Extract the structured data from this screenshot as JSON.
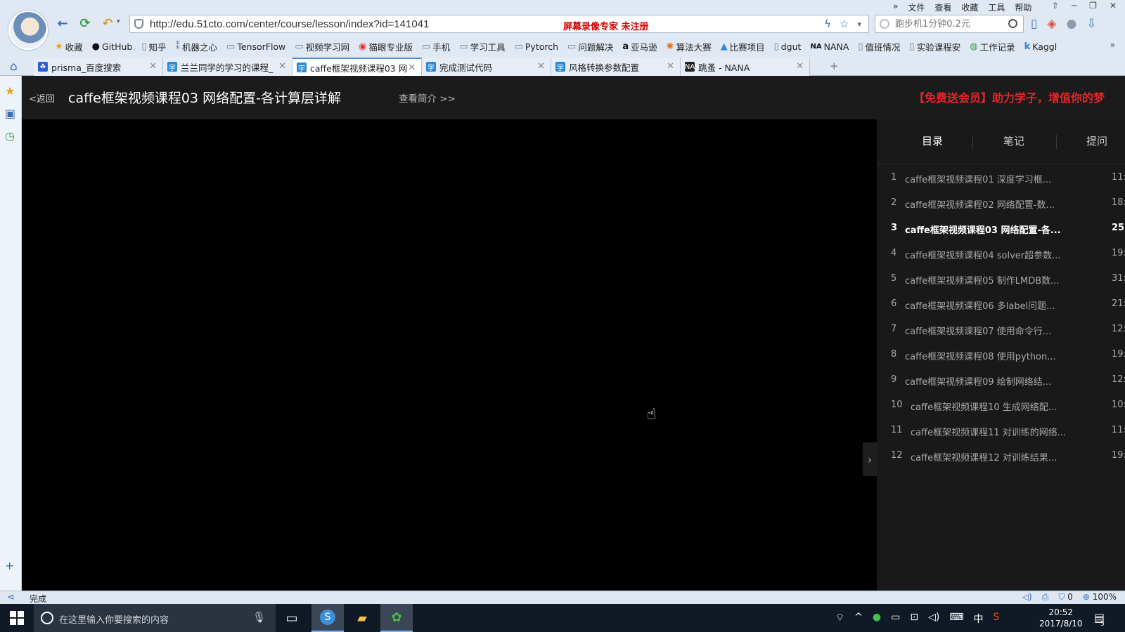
{
  "browser": {
    "url": "http://edu.51cto.com/center/course/lesson/index?id=141041",
    "watermark": "屏幕录像专家  未注册",
    "search_placeholder": "跑步机1分钟0.2元",
    "menu": [
      "文件",
      "查看",
      "收藏",
      "工具",
      "帮助"
    ],
    "status_text": "完成",
    "status_count": "0",
    "zoom": "100%"
  },
  "bookmarks": [
    {
      "label": "收藏",
      "icon": "star-icon"
    },
    {
      "label": "GitHub",
      "icon": "github-icon"
    },
    {
      "label": "知乎",
      "icon": "page-icon"
    },
    {
      "label": "机器之心",
      "icon": "jiqizhixin-icon"
    },
    {
      "label": "TensorFlow",
      "icon": "folder-icon"
    },
    {
      "label": "视频学习网",
      "icon": "folder-icon"
    },
    {
      "label": "猫眼专业版",
      "icon": "maoyan-icon"
    },
    {
      "label": "手机",
      "icon": "folder-icon"
    },
    {
      "label": "学习工具",
      "icon": "folder-icon"
    },
    {
      "label": "Pytorch",
      "icon": "folder-icon"
    },
    {
      "label": "问题解决",
      "icon": "folder-icon"
    },
    {
      "label": "亚马逊",
      "icon": "amazon-icon"
    },
    {
      "label": "算法大赛",
      "icon": "tianchi-icon"
    },
    {
      "label": "比赛项目",
      "icon": "flask-icon"
    },
    {
      "label": "dgut",
      "icon": "page-icon"
    },
    {
      "label": "NANA",
      "icon": "nana-icon"
    },
    {
      "label": "值班情况",
      "icon": "page-icon"
    },
    {
      "label": "实验课程安",
      "icon": "page-icon"
    },
    {
      "label": "工作记录",
      "icon": "record-icon"
    },
    {
      "label": "Kaggl",
      "icon": "kaggle-icon"
    }
  ],
  "tabs": [
    {
      "label": "prisma_百度搜索",
      "favicon": "baidu-icon"
    },
    {
      "label": "兰兰同学的学习的课程_",
      "favicon": "51cto-icon"
    },
    {
      "label": "caffe框架视频课程03 网",
      "favicon": "51cto-icon"
    },
    {
      "label": "完成测试代码",
      "favicon": "51cto-icon"
    },
    {
      "label": "风格转换参数配置",
      "favicon": "51cto-icon"
    },
    {
      "label": "跳蚤 - NANA",
      "favicon": "nana-icon"
    }
  ],
  "page": {
    "back": "<返回",
    "title": "caffe框架视频课程03 网络配置-各计算层详解",
    "intro": "查看简介 >>",
    "promo": "【免费送会员】助力学子，增值你的梦"
  },
  "panel": {
    "tabs": [
      "目录",
      "笔记",
      "提问"
    ],
    "lessons": [
      {
        "num": "1",
        "title": "caffe框架视频课程01 深度学习框...",
        "dur": "11:"
      },
      {
        "num": "2",
        "title": "caffe框架视频课程02 网络配置-数...",
        "dur": "18:"
      },
      {
        "num": "3",
        "title": "caffe框架视频课程03 网络配置-各...",
        "dur": "25:"
      },
      {
        "num": "4",
        "title": "caffe框架视频课程04 solver超参数...",
        "dur": "19:"
      },
      {
        "num": "5",
        "title": "caffe框架视频课程05 制作LMDB数...",
        "dur": "31:"
      },
      {
        "num": "6",
        "title": "caffe框架视频课程06 多label问题...",
        "dur": "21:"
      },
      {
        "num": "7",
        "title": "caffe框架视频课程07 使用命令行...",
        "dur": "12:"
      },
      {
        "num": "8",
        "title": "caffe框架视频课程08 使用python...",
        "dur": "19:"
      },
      {
        "num": "9",
        "title": "caffe框架视频课程09 绘制网络结...",
        "dur": "12:"
      },
      {
        "num": "10",
        "title": "caffe框架视频课程10 生成网络配...",
        "dur": "10:"
      },
      {
        "num": "11",
        "title": "caffe框架视频课程11 对训练的网络...",
        "dur": "11:"
      },
      {
        "num": "12",
        "title": "caffe框架视频课程12 对训练结果...",
        "dur": "19:"
      }
    ]
  },
  "taskbar": {
    "search_placeholder": "在这里输入你要搜索的内容",
    "ime": "中",
    "time": "20:52",
    "date": "2017/8/10",
    "notifications": "5"
  }
}
